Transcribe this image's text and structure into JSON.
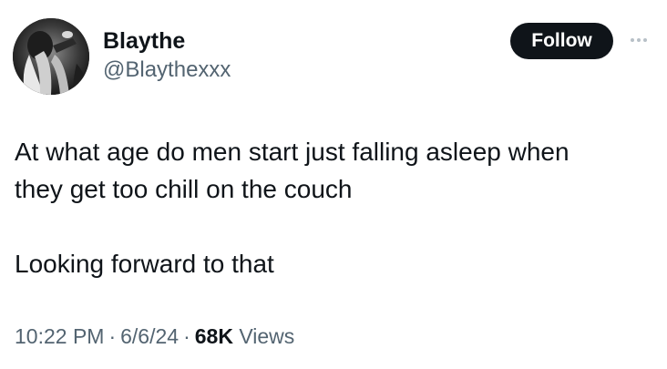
{
  "author": {
    "display_name": "Blaythe",
    "handle": "@Blaythexxx",
    "avatar_icon": "profile-photo"
  },
  "actions": {
    "follow_label": "Follow",
    "more_icon": "more-horizontal-icon"
  },
  "tweet": {
    "line1": "At what age do men start just falling asleep when",
    "line2": "they get too chill on the couch",
    "line3": "Looking forward to that"
  },
  "meta": {
    "time": "10:22 PM",
    "separator": "·",
    "date": "6/6/24",
    "views_count": "68K",
    "views_label": "Views"
  },
  "colors": {
    "text_primary": "#0f1419",
    "text_secondary": "#536471",
    "follow_bg": "#0f1419",
    "follow_text": "#ffffff"
  }
}
